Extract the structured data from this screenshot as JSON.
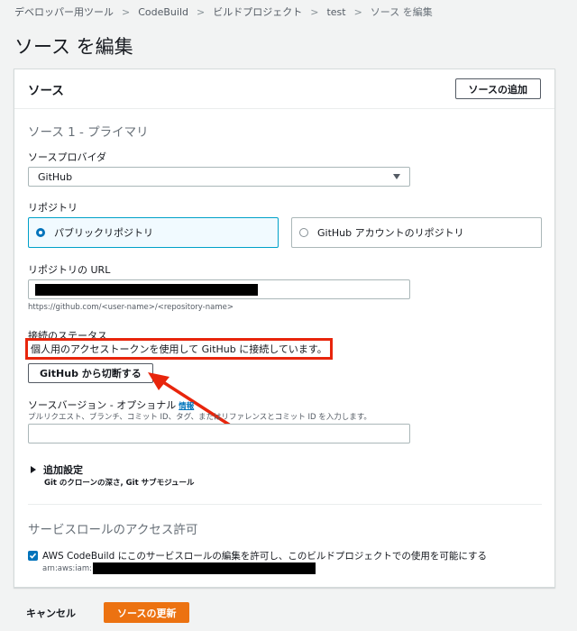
{
  "breadcrumb": {
    "items": [
      "デベロッパー用ツール",
      "CodeBuild",
      "ビルドプロジェクト",
      "test"
    ],
    "current": "ソース を編集"
  },
  "page_title": "ソース を編集",
  "panel": {
    "title": "ソース",
    "add_source_button": "ソースの追加",
    "source_section_title": "ソース 1 - プライマリ",
    "provider": {
      "label": "ソースプロバイダ",
      "value": "GitHub"
    },
    "repository": {
      "label": "リポジトリ",
      "options": [
        {
          "label": "パブリックリポジトリ",
          "selected": true
        },
        {
          "label": "GitHub アカウントのリポジトリ",
          "selected": false
        }
      ]
    },
    "repo_url": {
      "label": "リポジトリの URL",
      "hint": "https://github.com/<user-name>/<repository-name>"
    },
    "connection": {
      "label": "接続のステータス",
      "status": "個人用のアクセストークンを使用して GitHub に接続しています。",
      "disconnect_button": "GitHub から切断する"
    },
    "source_version": {
      "label": "ソースバージョン - オプショナル",
      "info_link": "情報",
      "description": "プルリクエスト、ブランチ、コミット ID、タグ、またはリファレンスとコミット ID を入力します。"
    },
    "additional_settings": {
      "title": "追加設定",
      "subtitle": "Git のクローンの深さ, Git サブモジュール"
    },
    "service_role_section_title": "サービスロールのアクセス許可",
    "service_role": {
      "checkbox_label": "AWS CodeBuild にこのサービスロールの編集を許可し、このビルドプロジェクトでの使用を可能にする",
      "arn_prefix": "arn:aws:iam::"
    }
  },
  "footer": {
    "cancel": "キャンセル",
    "update": "ソースの更新"
  },
  "colors": {
    "accent_blue": "#0073bb",
    "primary_orange": "#ec7211",
    "annotation_red": "#e8250c"
  }
}
